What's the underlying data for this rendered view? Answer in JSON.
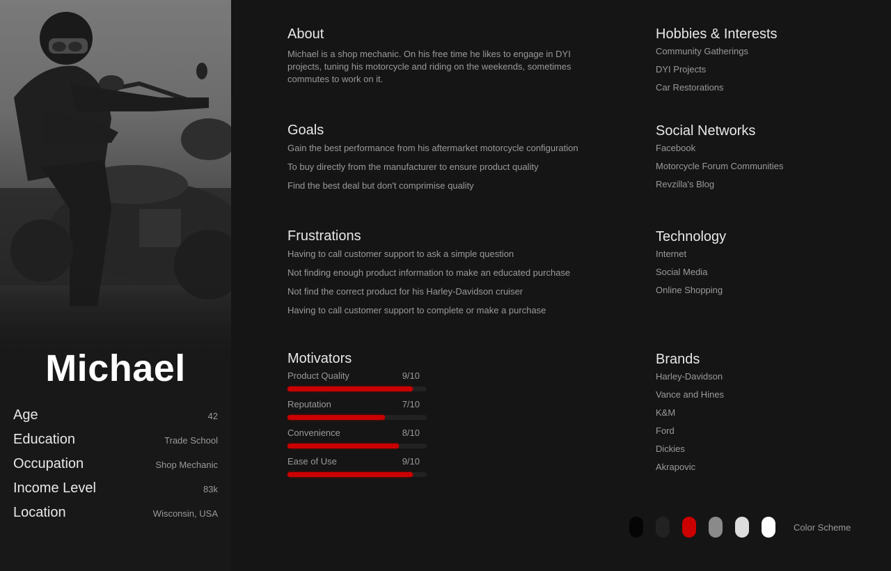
{
  "persona": {
    "name": "Michael",
    "photo_alt": "Rider in helmet and leather jacket seated on a Harley-Davidson motorcycle",
    "demographics": [
      {
        "label": "Age",
        "value": "42"
      },
      {
        "label": "Education",
        "value": "Trade School"
      },
      {
        "label": "Occupation",
        "value": "Shop Mechanic"
      },
      {
        "label": "Income Level",
        "value": "83k"
      },
      {
        "label": "Location",
        "value": "Wisconsin, USA"
      }
    ]
  },
  "about": {
    "title": "About",
    "text": "Michael is a shop mechanic. On his free time he likes to engage in DYI projects, tuning his motorcycle and riding on the weekends, sometimes commutes to work on it."
  },
  "goals": {
    "title": "Goals",
    "items": [
      "Gain the best performance from his aftermarket motorcycle configuration",
      "To buy directly from the manufacturer to ensure product quality",
      "Find the best deal but don't comprimise quality"
    ]
  },
  "frustrations": {
    "title": "Frustrations",
    "items": [
      "Having to call customer support to ask a simple question",
      "Not finding enough product information to make an educated purchase",
      "Not find the correct product for his Harley-Davidson cruiser",
      "Having to call customer support to complete or make a purchase"
    ]
  },
  "motivators": {
    "title": "Motivators",
    "items": [
      {
        "label": "Product Quality",
        "score_text": "9/10",
        "score": 9,
        "max": 10
      },
      {
        "label": "Reputation",
        "score_text": "7/10",
        "score": 7,
        "max": 10
      },
      {
        "label": "Convenience",
        "score_text": "8/10",
        "score": 8,
        "max": 10
      },
      {
        "label": "Ease of Use",
        "score_text": "9/10",
        "score": 9,
        "max": 10
      }
    ],
    "bar_color": "#cc0000"
  },
  "hobbies": {
    "title": "Hobbies & Interests",
    "items": [
      "Community Gatherings",
      "DYI Projects",
      "Car Restorations"
    ]
  },
  "social_networks": {
    "title": "Social Networks",
    "items": [
      "Facebook",
      "Motorcycle Forum Communities",
      "Revzilla's Blog"
    ]
  },
  "technology": {
    "title": "Technology",
    "items": [
      "Internet",
      "Social Media",
      "Online Shopping"
    ]
  },
  "brands": {
    "title": "Brands",
    "items": [
      "Harley-Davidson",
      "Vance and Hines",
      "K&M",
      "Ford",
      "Dickies",
      "Akrapovic"
    ]
  },
  "color_scheme": {
    "label": "Color Scheme",
    "colors": [
      "#050505",
      "#222222",
      "#cc0000",
      "#8a8a8a",
      "#dddddd",
      "#ffffff"
    ]
  }
}
